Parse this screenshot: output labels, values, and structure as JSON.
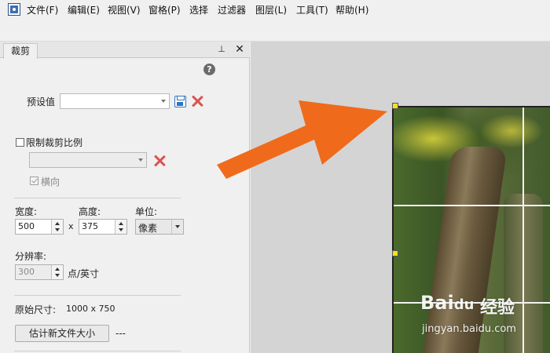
{
  "menubar": {
    "items": [
      "文件(F)",
      "编辑(E)",
      "视图(V)",
      "窗格(P)",
      "选择",
      "过滤器",
      "图层(L)",
      "工具(T)",
      "帮助(H)"
    ]
  },
  "panel": {
    "tab_label": "裁剪",
    "pin_glyph": "⊥",
    "close_glyph": "✕",
    "help_glyph": "?",
    "preset_label": "预设值",
    "preset_value": "",
    "constrain_label": "限制裁剪比例",
    "constrain_checked": false,
    "ratio_value": "",
    "landscape_label": "横向",
    "landscape_checked": true,
    "width_label": "宽度:",
    "height_label": "高度:",
    "unit_label": "单位:",
    "width_value": "500",
    "times_glyph": "x",
    "height_value": "375",
    "unit_value": "像素",
    "resolution_label": "分辨率:",
    "resolution_value": "300",
    "resolution_unit": "点/英寸",
    "original_size_label": "原始尺寸:",
    "original_size_value": "1000 x 750",
    "estimate_button": "估计新文件大小",
    "estimate_result": "---"
  },
  "watermark": {
    "logo": "Bai",
    "logo_paw": "du",
    "cn": "经验",
    "url": "jingyan.baidu.com"
  },
  "colors": {
    "arrow": "#f06a1c",
    "handle": "#f3e21f",
    "accent_blue": "#2f74c0",
    "delete_red": "#d9534f"
  }
}
